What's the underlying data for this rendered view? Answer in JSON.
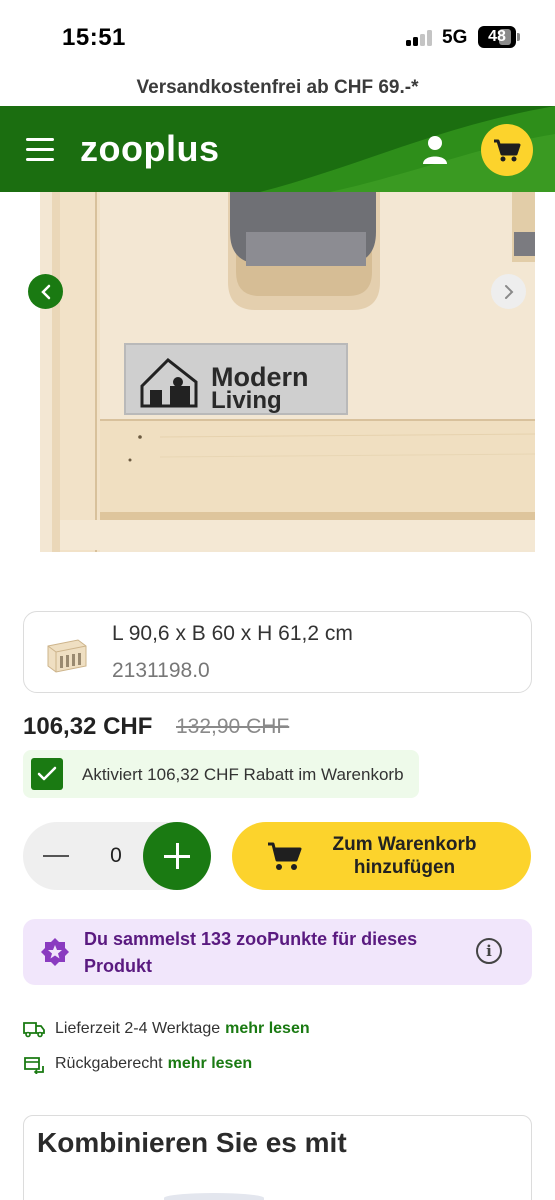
{
  "status_bar": {
    "time": "15:51",
    "network": "5G",
    "battery": "48"
  },
  "promo_banner": "Versandkostenfrei ab CHF 69.-*",
  "header": {
    "logo": "zooplus",
    "brand_color": "#1a6d0e",
    "cart_color": "#fcd32c"
  },
  "gallery": {
    "image_label_line1": "Modern",
    "image_label_line2": "Living"
  },
  "variant": {
    "size": "L 90,6 x B 60 x H 61,2 cm",
    "sku": "2131198.0"
  },
  "pricing": {
    "price": "106,32 CHF",
    "old_price": "132,90 CHF",
    "discount_text": "Aktiviert 106,32 CHF Rabatt im Warenkorb"
  },
  "quantity": {
    "value": "0"
  },
  "add_to_cart": {
    "label": "Zum Warenkorb hinzufügen"
  },
  "points": {
    "text": "Du sammelst 133 zooPunkte für dieses Produkt",
    "color": "#5a1a80"
  },
  "delivery": {
    "delivery_time": "Lieferzeit 2-4 Werktage",
    "delivery_more": "mehr lesen",
    "return_text": "Rückgaberecht",
    "return_more": "mehr lesen"
  },
  "combine": {
    "title": "Kombinieren Sie es mit"
  },
  "accent_green": "#1a7a12"
}
